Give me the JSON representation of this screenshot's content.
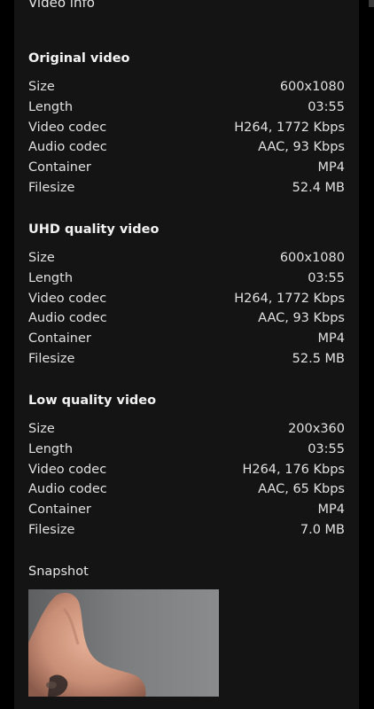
{
  "panel": {
    "title": "Video info"
  },
  "sections": [
    {
      "heading": "Original video",
      "rows": [
        {
          "key": "Size",
          "value": "600x1080"
        },
        {
          "key": "Length",
          "value": "03:55"
        },
        {
          "key": "Video codec",
          "value": "H264, 1772 Kbps"
        },
        {
          "key": "Audio codec",
          "value": "AAC, 93 Kbps"
        },
        {
          "key": "Container",
          "value": "MP4"
        },
        {
          "key": "Filesize",
          "value": "52.4 MB"
        }
      ]
    },
    {
      "heading": "UHD quality video",
      "rows": [
        {
          "key": "Size",
          "value": "600x1080"
        },
        {
          "key": "Length",
          "value": "03:55"
        },
        {
          "key": "Video codec",
          "value": "H264, 1772 Kbps"
        },
        {
          "key": "Audio codec",
          "value": "AAC, 93 Kbps"
        },
        {
          "key": "Container",
          "value": "MP4"
        },
        {
          "key": "Filesize",
          "value": "52.5 MB"
        }
      ]
    },
    {
      "heading": "Low quality video",
      "rows": [
        {
          "key": "Size",
          "value": "200x360"
        },
        {
          "key": "Length",
          "value": "03:55"
        },
        {
          "key": "Video codec",
          "value": "H264, 176 Kbps"
        },
        {
          "key": "Audio codec",
          "value": "AAC, 65 Kbps"
        },
        {
          "key": "Container",
          "value": "MP4"
        },
        {
          "key": "Filesize",
          "value": "7.0 MB"
        }
      ]
    }
  ],
  "snapshot": {
    "label": "Snapshot"
  }
}
